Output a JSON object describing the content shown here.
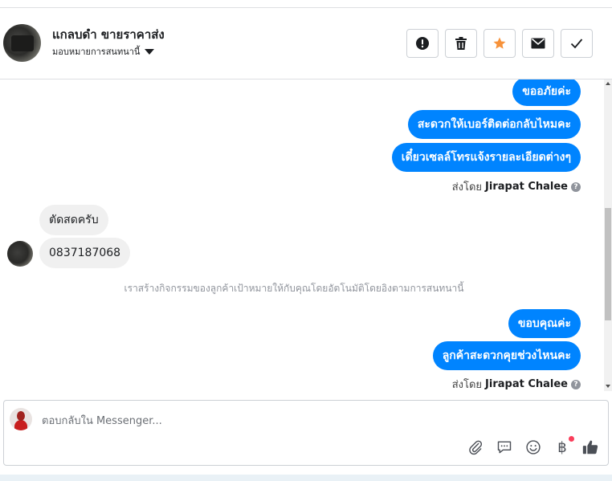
{
  "header": {
    "contact_name": "แกลบดำ ขายราคาส่ง",
    "assign_label": "มอบหมายการสนทนานี้",
    "buttons": [
      {
        "name": "report",
        "icon": "exclamation-icon"
      },
      {
        "name": "delete",
        "icon": "trash-icon"
      },
      {
        "name": "star",
        "icon": "star-icon",
        "color": "#f7923a"
      },
      {
        "name": "mark-unread",
        "icon": "envelope-icon"
      },
      {
        "name": "done",
        "icon": "checkmark-icon"
      }
    ]
  },
  "messages": {
    "out_1": "ขออภัยค่ะ",
    "out_2": "สะดวกให้เบอร์ติดต่อกลับไหมคะ",
    "out_3": "เดี๋ยวเซลล์โทรแจ้งรายละเอียดต่างๆ",
    "sent_by_1_prefix": "ส่งโดย",
    "sent_by_1_name": "Jirapat Chalee",
    "in_1": "ตัดสดครับ",
    "in_2": "0837187068",
    "system_note": "เราสร้างกิจกรรมของลูกค้าเป้าหมายให้กับคุณโดยอัตโนมัติโดยอิงตามการสนทนานี้",
    "out_4": "ขอบคุณค่ะ",
    "out_5": "ลูกค้าสะดวกคุยช่วงไหนคะ",
    "sent_by_2_prefix": "ส่งโดย",
    "sent_by_2_name": "Jirapat Chalee"
  },
  "composer": {
    "placeholder": "ตอบกลับใน Messenger...",
    "tools": [
      "paperclip-icon",
      "saved-reply-icon",
      "emoji-icon",
      "baht-payment-icon",
      "thumbs-up-icon"
    ],
    "baht_symbol": "฿"
  },
  "colors": {
    "accent": "#0084ff",
    "bubble_in": "#f0f0f0",
    "star": "#f7923a",
    "notification_dot": "#fa3e5b"
  }
}
